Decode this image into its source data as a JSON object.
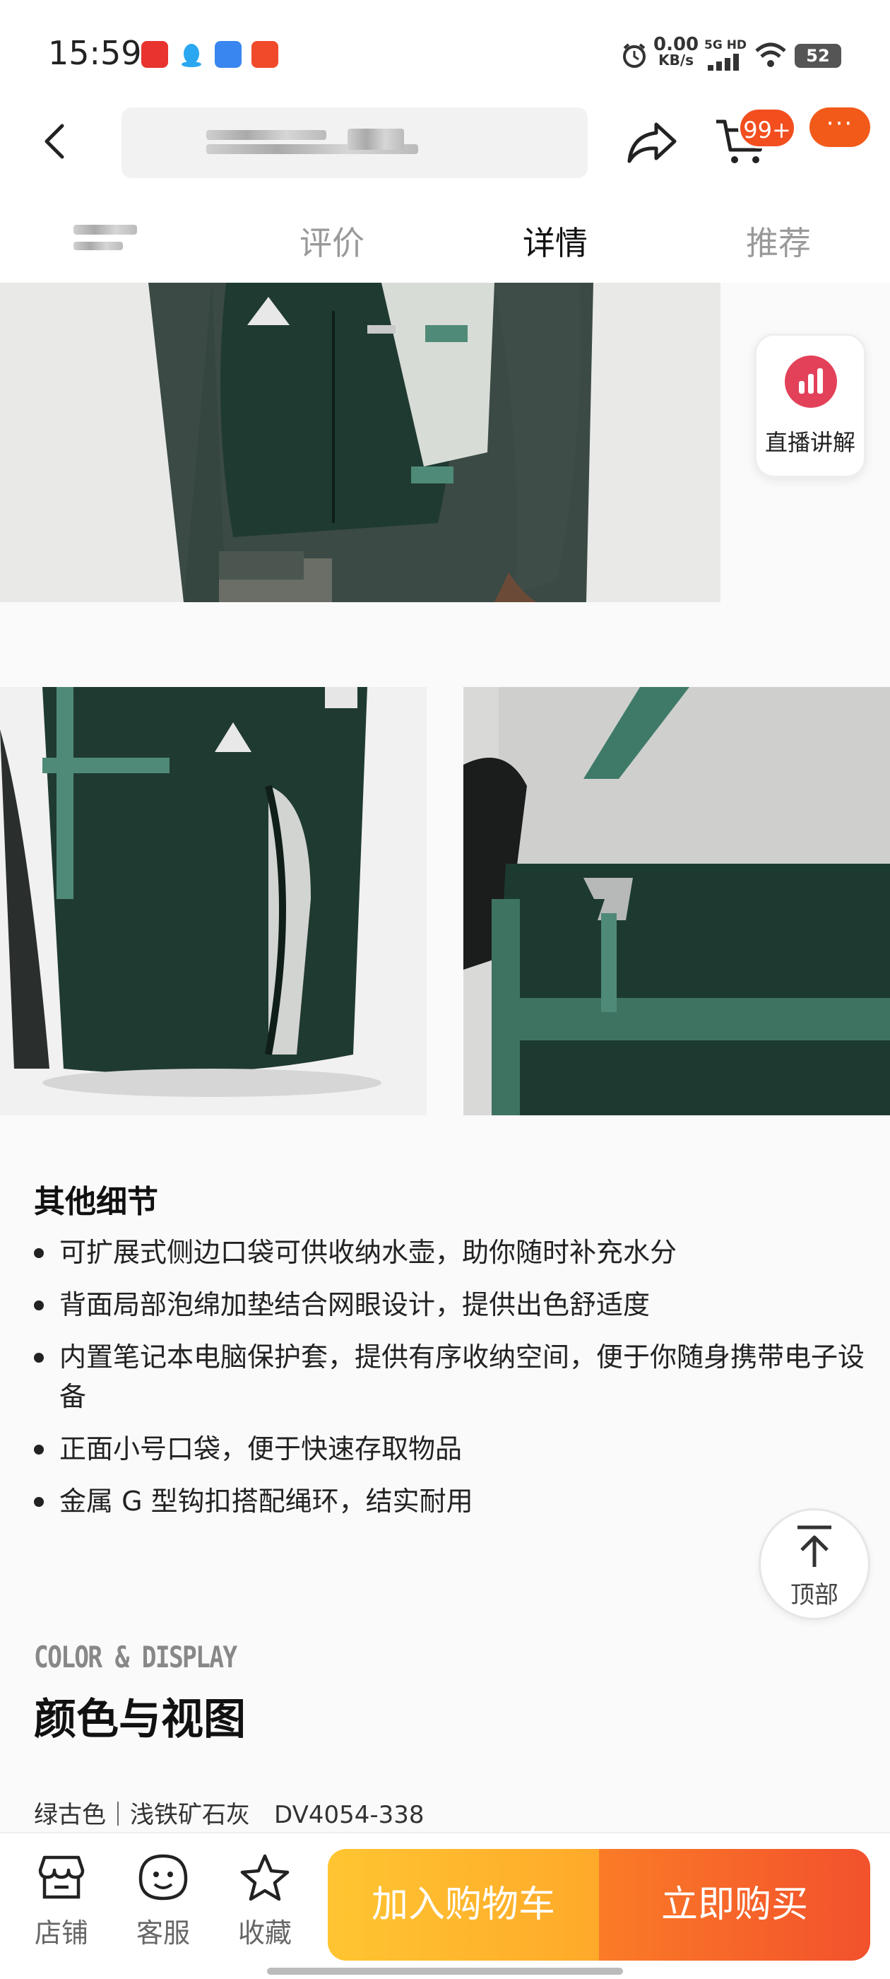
{
  "status_bar": {
    "time": "15:59",
    "net_speed_value": "0.00",
    "net_speed_unit": "KB/s",
    "network_type": "5G HD",
    "battery": "52"
  },
  "header": {
    "cart_badge": "99+",
    "more_label": "···"
  },
  "tabs": [
    {
      "label": "评价",
      "active": false
    },
    {
      "label": "详情",
      "active": true
    },
    {
      "label": "推荐",
      "active": false
    }
  ],
  "live_widget": {
    "label": "直播讲解",
    "icon": "live-bars-icon"
  },
  "details": {
    "title": "其他细节",
    "bullets": [
      "可扩展式侧边口袋可供收纳水壶，助你随时补充水分",
      "背面局部泡绵加垫结合网眼设计，提供出色舒适度",
      "内置笔记本电脑保护套，提供有序收纳空间，便于你随身携带电子设备",
      "正面小号口袋，便于快速存取物品",
      "金属 G 型钩扣搭配绳环，结实耐用"
    ]
  },
  "back_to_top": {
    "label": "顶部"
  },
  "color_section": {
    "title_en": "COLOR & DISPLAY",
    "title_cn": "颜色与视图",
    "variant_color": "绿古色｜浅铁矿石灰",
    "variant_code": "DV4054-338"
  },
  "bottom_bar": {
    "shop_label": "店铺",
    "service_label": "客服",
    "favorite_label": "收藏",
    "add_to_cart_label": "加入购物车",
    "buy_now_label": "立即购买"
  },
  "colors": {
    "accent_orange": "#f25a1a",
    "cart_yellow": "#ffb52e",
    "buy_orange": "#f4602a",
    "live_pink": "#e3415a",
    "backpack_green": "#1f3a31",
    "strap_teal": "#4f8a78"
  }
}
